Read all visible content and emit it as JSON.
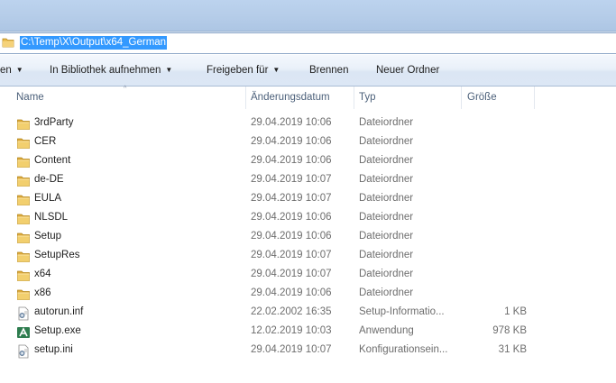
{
  "address": {
    "path": "C:\\Temp\\X\\Output\\x64_German",
    "icon": "folder-icon"
  },
  "toolbar": {
    "organize_fragment": "en",
    "library_label": "In Bibliothek aufnehmen",
    "share_label": "Freigeben für",
    "burn_label": "Brennen",
    "new_folder_label": "Neuer Ordner",
    "dropdown_glyph": "▼"
  },
  "columns": {
    "name": "Name",
    "date": "Änderungsdatum",
    "type": "Typ",
    "size": "Größe",
    "sort_glyph": "^"
  },
  "files": [
    {
      "name": "3rdParty",
      "date": "29.04.2019 10:06",
      "type": "Dateiordner",
      "size": "",
      "icon": "folder-icon"
    },
    {
      "name": "CER",
      "date": "29.04.2019 10:06",
      "type": "Dateiordner",
      "size": "",
      "icon": "folder-icon"
    },
    {
      "name": "Content",
      "date": "29.04.2019 10:06",
      "type": "Dateiordner",
      "size": "",
      "icon": "folder-icon"
    },
    {
      "name": "de-DE",
      "date": "29.04.2019 10:07",
      "type": "Dateiordner",
      "size": "",
      "icon": "folder-icon"
    },
    {
      "name": "EULA",
      "date": "29.04.2019 10:07",
      "type": "Dateiordner",
      "size": "",
      "icon": "folder-icon"
    },
    {
      "name": "NLSDL",
      "date": "29.04.2019 10:06",
      "type": "Dateiordner",
      "size": "",
      "icon": "folder-icon"
    },
    {
      "name": "Setup",
      "date": "29.04.2019 10:06",
      "type": "Dateiordner",
      "size": "",
      "icon": "folder-icon"
    },
    {
      "name": "SetupRes",
      "date": "29.04.2019 10:07",
      "type": "Dateiordner",
      "size": "",
      "icon": "folder-icon"
    },
    {
      "name": "x64",
      "date": "29.04.2019 10:07",
      "type": "Dateiordner",
      "size": "",
      "icon": "folder-icon"
    },
    {
      "name": "x86",
      "date": "29.04.2019 10:06",
      "type": "Dateiordner",
      "size": "",
      "icon": "folder-icon"
    },
    {
      "name": "autorun.inf",
      "date": "22.02.2002 16:35",
      "type": "Setup-Informatio...",
      "size": "1 KB",
      "icon": "settings-file-icon"
    },
    {
      "name": "Setup.exe",
      "date": "12.02.2019 10:03",
      "type": "Anwendung",
      "size": "978 KB",
      "icon": "application-icon"
    },
    {
      "name": "setup.ini",
      "date": "29.04.2019 10:07",
      "type": "Konfigurationsein...",
      "size": "31 KB",
      "icon": "settings-file-icon"
    }
  ]
}
